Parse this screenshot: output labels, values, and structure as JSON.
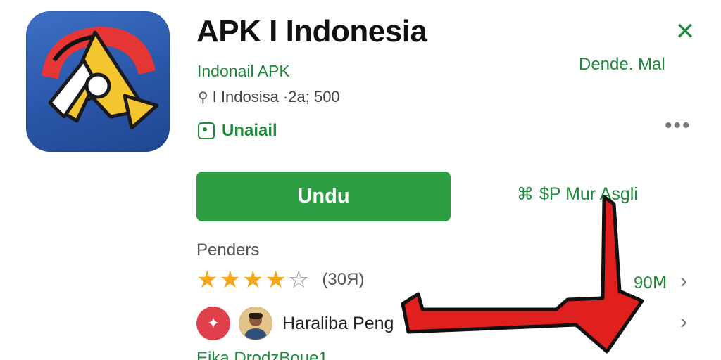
{
  "app": {
    "title": "APK I Indonesia",
    "developer": "Indonail APK",
    "meta_text": "I Indosisa ·2a; 500",
    "install_label": "Unaiail",
    "top_right_link": "Dende. Mal",
    "download_label": "Undu",
    "secondary_action_label": "$P Mur Asgli"
  },
  "reviews": {
    "label": "Penders",
    "rating": 4,
    "max_rating": 5,
    "count_label": "(30Я)",
    "size_value": "90Ⅿ",
    "reviewer_name": "Haraliba Peng",
    "footer_text": "Eika DrodzBoue1"
  },
  "icons": {
    "close": "close-icon",
    "more": "more-horizontal-icon",
    "install": "install-icon",
    "leaf": "leaf-icon",
    "chevron": "chevron-right-icon"
  },
  "colors": {
    "accent_green": "#1f8a3c",
    "button_green": "#2e9e45",
    "star": "#f4a51c",
    "annotation_red": "#e01f1f"
  }
}
